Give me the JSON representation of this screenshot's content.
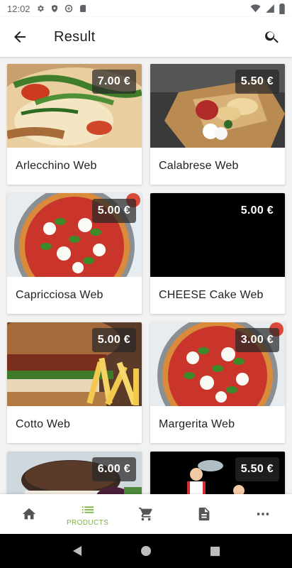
{
  "status_bar": {
    "time": "12:02"
  },
  "app_bar": {
    "title": "Result"
  },
  "products": [
    {
      "name": "Arlecchino Web",
      "price": "7.00 €",
      "image": "pizza-rucola"
    },
    {
      "name": "Calabrese Web",
      "price": "5.50 €",
      "image": "takeaway-box"
    },
    {
      "name": "Capricciosa Web",
      "price": "5.00 €",
      "image": "pizza-margherita"
    },
    {
      "name": "CHEESE Cake Web",
      "price": "5.00 €",
      "image": "black"
    },
    {
      "name": "Cotto Web",
      "price": "5.00 €",
      "image": "burger-fries"
    },
    {
      "name": "Margerita Web",
      "price": "3.00 €",
      "image": "pizza-margherita"
    },
    {
      "name": "",
      "price": "6.00 €",
      "image": "burger"
    },
    {
      "name": "",
      "price": "5.50 €",
      "image": "waiter-illustration"
    }
  ],
  "bottom_nav": {
    "items": [
      {
        "icon": "home-icon",
        "label": ""
      },
      {
        "icon": "list-icon",
        "label": "PRODUCTS"
      },
      {
        "icon": "cart-icon",
        "label": ""
      },
      {
        "icon": "document-icon",
        "label": ""
      },
      {
        "icon": "more-icon",
        "label": ""
      }
    ],
    "active_color": "#7cb342"
  }
}
